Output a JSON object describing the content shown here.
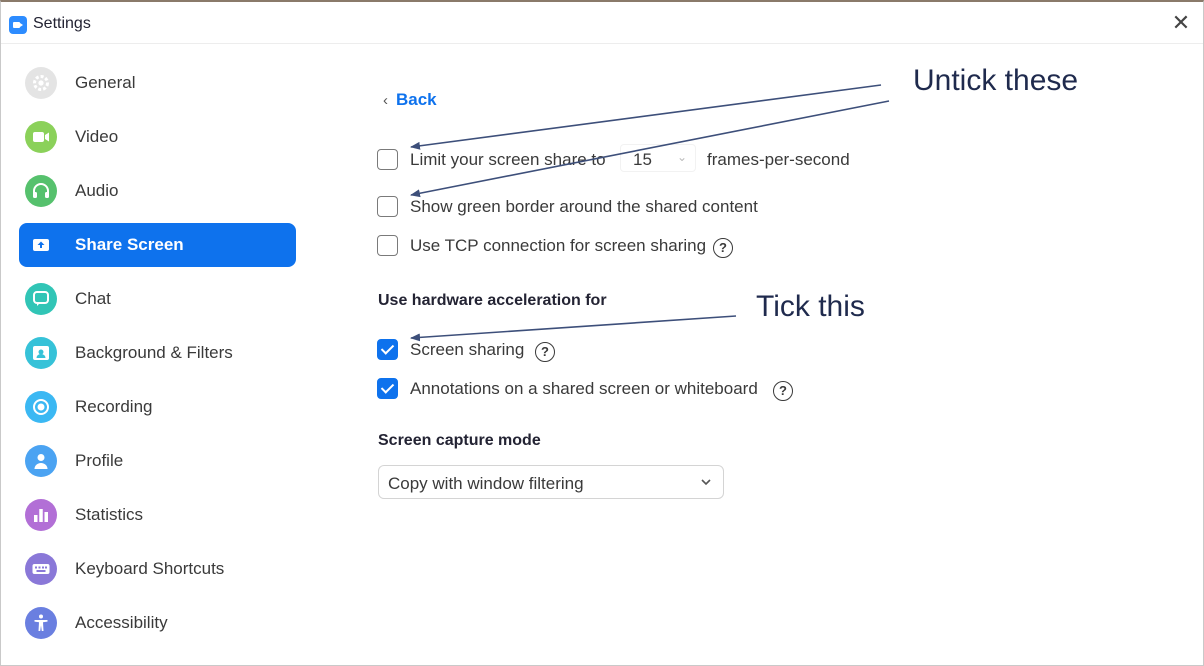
{
  "window": {
    "title": "Settings",
    "close_glyph": "✕"
  },
  "sidebar": {
    "items": [
      {
        "label": "General",
        "icon": "gear-icon",
        "color": "#e0e0e0",
        "active": false
      },
      {
        "label": "Video",
        "icon": "video-camera-icon",
        "color": "#8bd15a",
        "active": false
      },
      {
        "label": "Audio",
        "icon": "headphones-icon",
        "color": "#56c16d",
        "active": false
      },
      {
        "label": "Share Screen",
        "icon": "share-screen-icon",
        "color": "#ffffff",
        "active": true
      },
      {
        "label": "Chat",
        "icon": "chat-bubble-icon",
        "color": "#31c5b6",
        "active": false
      },
      {
        "label": "Background & Filters",
        "icon": "background-person-icon",
        "color": "#36c2d8",
        "active": false
      },
      {
        "label": "Recording",
        "icon": "record-icon",
        "color": "#3bb8f3",
        "active": false
      },
      {
        "label": "Profile",
        "icon": "profile-person-icon",
        "color": "#4ba3f2",
        "active": false
      },
      {
        "label": "Statistics",
        "icon": "bar-chart-icon",
        "color": "#b26fd6",
        "active": false
      },
      {
        "label": "Keyboard Shortcuts",
        "icon": "keyboard-icon",
        "color": "#8a78d8",
        "active": false
      },
      {
        "label": "Accessibility",
        "icon": "accessibility-icon",
        "color": "#6a7fe0",
        "active": false
      }
    ]
  },
  "main": {
    "back_label": "Back",
    "limit_fps": {
      "label": "Limit your screen share to",
      "checked": false,
      "value": "15",
      "suffix": "frames-per-second"
    },
    "green_border": {
      "label": "Show green border around the shared content",
      "checked": false
    },
    "tcp": {
      "label": "Use TCP connection for screen sharing",
      "checked": false
    },
    "hw_accel_heading": "Use hardware acceleration for",
    "hw_screen_sharing": {
      "label": "Screen sharing",
      "checked": true
    },
    "hw_annotations": {
      "label": "Annotations on a shared screen or whiteboard",
      "checked": true
    },
    "capture_heading": "Screen capture mode",
    "capture_mode": {
      "value": "Copy with window filtering"
    },
    "help_glyph": "?"
  },
  "annotations": {
    "untick": "Untick these",
    "tick": "Tick this",
    "arrow_color": "#3d4f7a"
  },
  "colors": {
    "accent": "#0e72ed",
    "text": "#3a3a3a"
  }
}
